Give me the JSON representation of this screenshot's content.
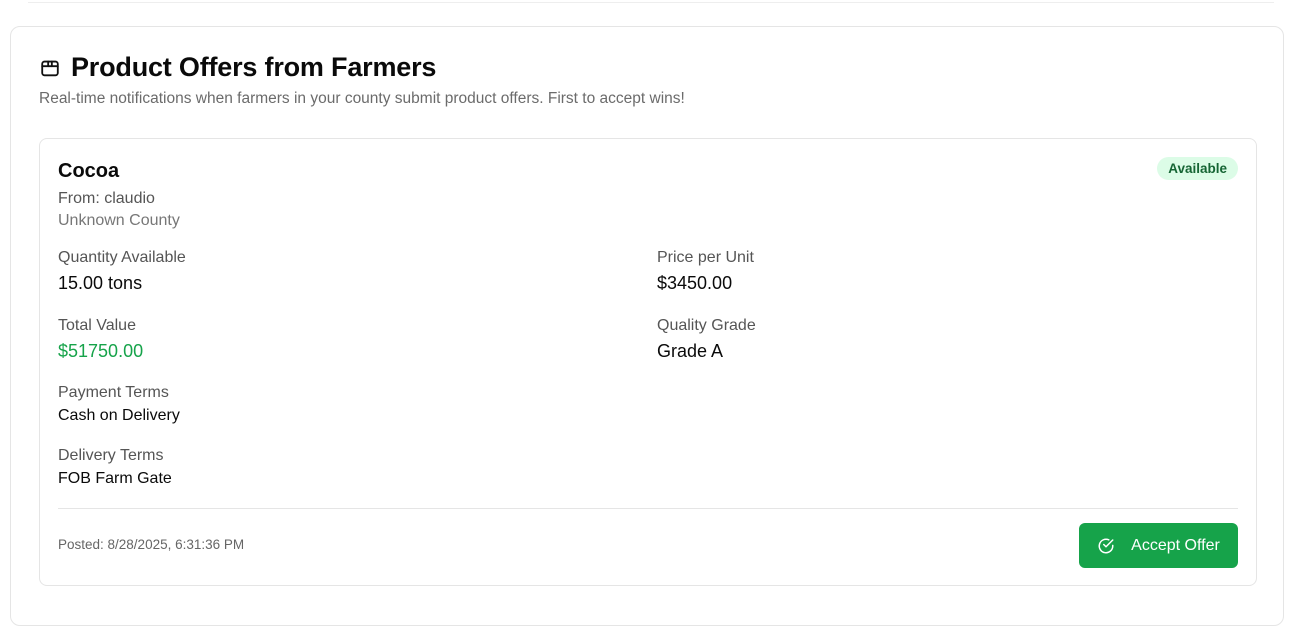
{
  "header": {
    "icon": "package-icon",
    "title": "Product Offers from Farmers",
    "subtitle": "Real-time notifications when farmers in your county submit product offers. First to accept wins!"
  },
  "offer": {
    "product": "Cocoa",
    "status": "Available",
    "from": "From: claudio",
    "county": "Unknown County",
    "fields": {
      "quantity_label": "Quantity Available",
      "quantity_value": "15.00 tons",
      "price_label": "Price per Unit",
      "price_value": "$3450.00",
      "total_label": "Total Value",
      "total_value": "$51750.00",
      "grade_label": "Quality Grade",
      "grade_value": "Grade A",
      "payment_label": "Payment Terms",
      "payment_value": "Cash on Delivery",
      "delivery_label": "Delivery Terms",
      "delivery_value": "FOB Farm Gate"
    },
    "posted": "Posted: 8/28/2025, 6:31:36 PM",
    "accept_label": "Accept Offer",
    "accept_icon": "check-circle-icon"
  },
  "colors": {
    "accent_green": "#16a34a",
    "badge_bg": "#dcfce7",
    "badge_text": "#166534"
  }
}
